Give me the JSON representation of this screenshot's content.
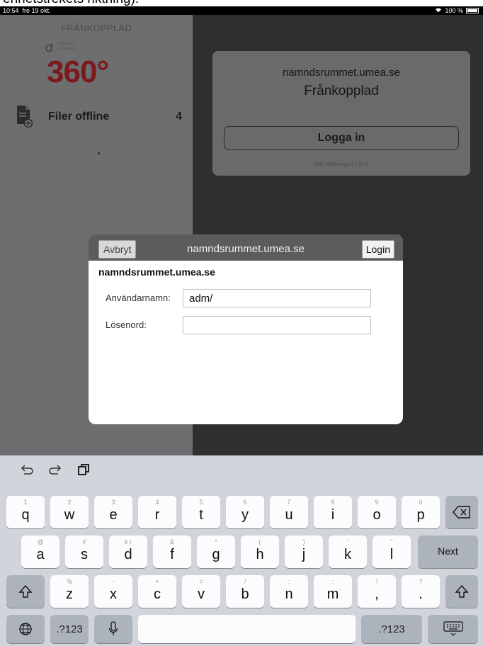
{
  "caption_fragment": "enhetstrekets riktning).",
  "status_bar": {
    "time": "10:54",
    "date": "fre 19 okt.",
    "battery": "100 %"
  },
  "sidebar": {
    "offline_label": "FRÅNKOPPLAD",
    "logo_small": [
      "Software",
      "Innovation"
    ],
    "logo_main": "360°",
    "files_label": "Filer offline",
    "files_count": "4"
  },
  "status_card": {
    "server": "namndsrummet.umea.se",
    "status": "Frånkopplad",
    "login_button": "Logga in",
    "version": "360° eMeetings 4.1.24.1"
  },
  "dialog": {
    "cancel": "Avbryt",
    "title": "namndsrummet.umea.se",
    "login": "Login",
    "server": "namndsrummet.umea.se",
    "username_label": "Användarnamn:",
    "username_value": "adm/",
    "password_label": "Lösenord:",
    "password_value": ""
  },
  "keyboard": {
    "row1": [
      {
        "alt": "1",
        "main": "q"
      },
      {
        "alt": "2",
        "main": "w"
      },
      {
        "alt": "3",
        "main": "e"
      },
      {
        "alt": "4",
        "main": "r"
      },
      {
        "alt": "5",
        "main": "t"
      },
      {
        "alt": "6",
        "main": "y"
      },
      {
        "alt": "7",
        "main": "u"
      },
      {
        "alt": "8",
        "main": "i"
      },
      {
        "alt": "9",
        "main": "o"
      },
      {
        "alt": "0",
        "main": "p"
      }
    ],
    "row2": [
      {
        "alt": "@",
        "main": "a"
      },
      {
        "alt": "#",
        "main": "s"
      },
      {
        "alt": "k r",
        "main": "d"
      },
      {
        "alt": "&",
        "main": "f"
      },
      {
        "alt": "*",
        "main": "g"
      },
      {
        "alt": "(",
        "main": "h"
      },
      {
        "alt": ")",
        "main": "j"
      },
      {
        "alt": "'",
        "main": "k"
      },
      {
        "alt": "\"",
        "main": "l"
      }
    ],
    "row3": [
      {
        "alt": "%",
        "main": "z"
      },
      {
        "alt": "-",
        "main": "x"
      },
      {
        "alt": "+",
        "main": "c"
      },
      {
        "alt": "=",
        "main": "v"
      },
      {
        "alt": "/",
        "main": "b"
      },
      {
        "alt": ";",
        "main": "n"
      },
      {
        "alt": ":",
        "main": "m"
      },
      {
        "alt": "!",
        "main": ","
      },
      {
        "alt": "?",
        "main": "."
      }
    ],
    "next_label": "Next",
    "numbers_label": ".?123"
  }
}
